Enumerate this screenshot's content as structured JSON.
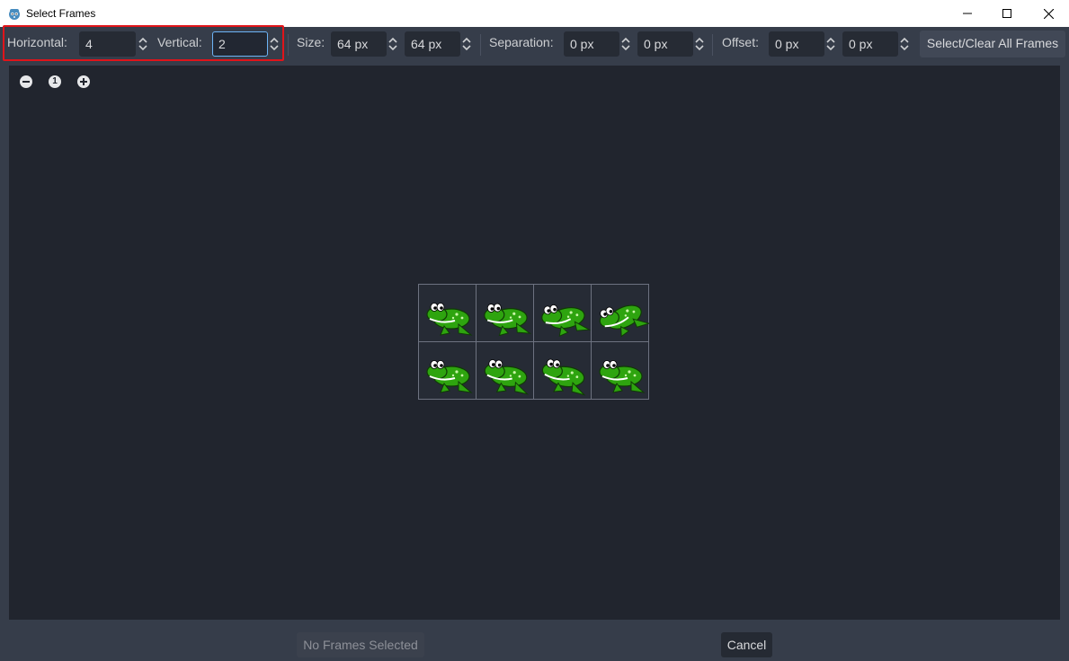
{
  "window": {
    "title": "Select Frames",
    "app_icon": "godot-icon",
    "controls": [
      "minimize-icon",
      "maximize-icon",
      "close-icon"
    ]
  },
  "toolbar": {
    "horizontal_label": "Horizontal:",
    "horizontal_value": "4",
    "vertical_label": "Vertical:",
    "vertical_value": "2",
    "size_label": "Size:",
    "size_x": "64 px",
    "size_y": "64 px",
    "separation_label": "Separation:",
    "separation_x": "0 px",
    "separation_y": "0 px",
    "offset_label": "Offset:",
    "offset_x": "0 px",
    "offset_y": "0 px",
    "select_all_label": "Select/Clear All Frames"
  },
  "viewport": {
    "zoom_controls": [
      "zoom-out-icon",
      "zoom-reset-icon",
      "zoom-in-icon"
    ],
    "zoom_reset_text": "1",
    "grid": {
      "columns": 4,
      "rows": 2
    },
    "frames": [
      "frog-frame",
      "frog-frame",
      "frog-frame",
      "frog-frame",
      "frog-frame",
      "frog-frame",
      "frog-frame",
      "frog-frame"
    ]
  },
  "footer": {
    "confirm_label": "No Frames Selected",
    "cancel_label": "Cancel"
  },
  "colors": {
    "accent_focus": "#6cb3f5",
    "highlight_box": "#e0141a",
    "frog_green": "#2ea40f"
  }
}
